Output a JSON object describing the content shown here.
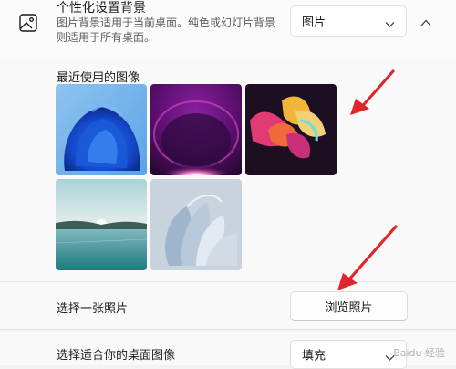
{
  "header": {
    "title": "个性化设置背景",
    "subtitle": "图片背景适用于当前桌面。纯色或幻灯片背景则适用于所有桌面。",
    "bg_type_value": "图片"
  },
  "gallery": {
    "label": "最近使用的图像",
    "images": [
      {
        "name": "Blue bloom"
      },
      {
        "name": "Purple glow"
      },
      {
        "name": "Colorful ribbon"
      },
      {
        "name": "Lake landscape"
      },
      {
        "name": "Paper bloom"
      }
    ]
  },
  "browse": {
    "label": "选择一张照片",
    "button_label": "浏览照片"
  },
  "fit": {
    "label": "选择适合你的桌面图像",
    "value": "填充"
  },
  "watermark": "Baidu 经验",
  "colors": {
    "accent_arrow": "#e0262d"
  }
}
